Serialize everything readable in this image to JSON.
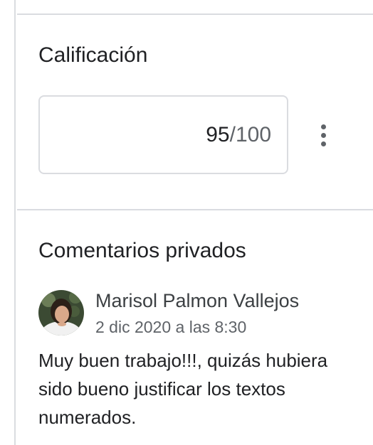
{
  "grade": {
    "title": "Calificación",
    "value": "95",
    "total": "/100",
    "more_icon": "more-vert-icon"
  },
  "private_comments": {
    "title": "Comentarios privados",
    "comments": [
      {
        "author": "Marisol Palmon Vallejos",
        "date": "2 dic 2020 a las 8:30",
        "text": "Muy buen trabajo!!!, quizás hubiera sido bueno justificar los textos numerados.",
        "avatar_icon": "user-avatar"
      }
    ]
  },
  "colors": {
    "divider": "#dadce0",
    "text_primary": "#202124",
    "text_secondary": "#5f6368"
  }
}
